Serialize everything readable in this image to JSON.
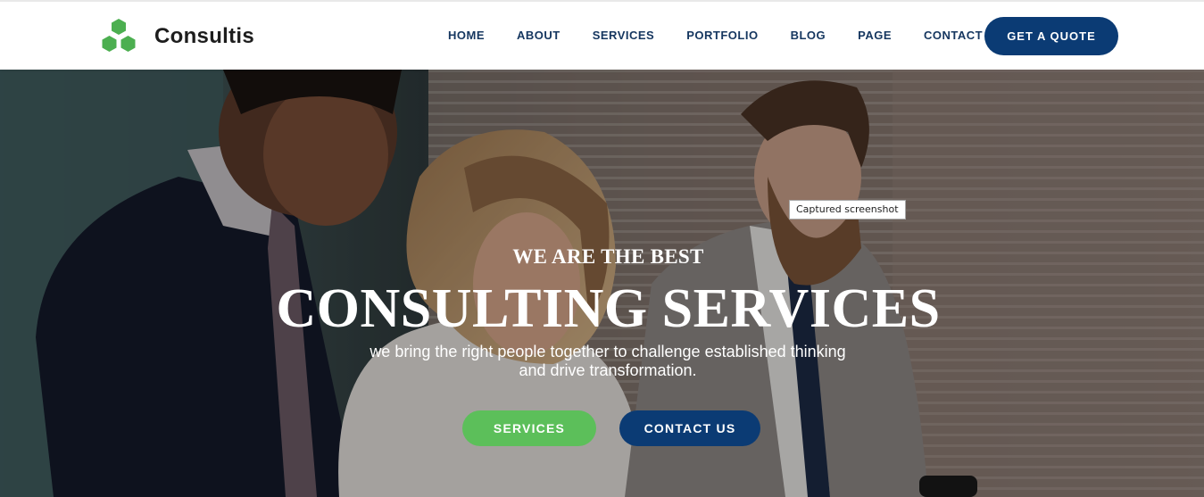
{
  "brand": {
    "name": "Consultis",
    "logo_icon": "hexagon-cluster-icon",
    "logo_color": "#4caf50"
  },
  "nav": {
    "items": [
      {
        "label": "HOME"
      },
      {
        "label": "ABOUT"
      },
      {
        "label": "SERVICES"
      },
      {
        "label": "PORTFOLIO"
      },
      {
        "label": "BLOG"
      },
      {
        "label": "PAGE"
      },
      {
        "label": "CONTACT"
      }
    ],
    "cta_label": "GET A QUOTE"
  },
  "hero": {
    "eyebrow": "WE ARE THE BEST",
    "headline": "CONSULTING SERVICES",
    "subtext": "we bring the right people together to challenge established thinking and drive transformation.",
    "primary_button": "SERVICES",
    "secondary_button": "CONTACT US"
  },
  "tooltip": {
    "text": "Captured screenshot"
  },
  "colors": {
    "navy": "#0b3b74",
    "green": "#5cbf5a",
    "nav_text": "#163760"
  }
}
